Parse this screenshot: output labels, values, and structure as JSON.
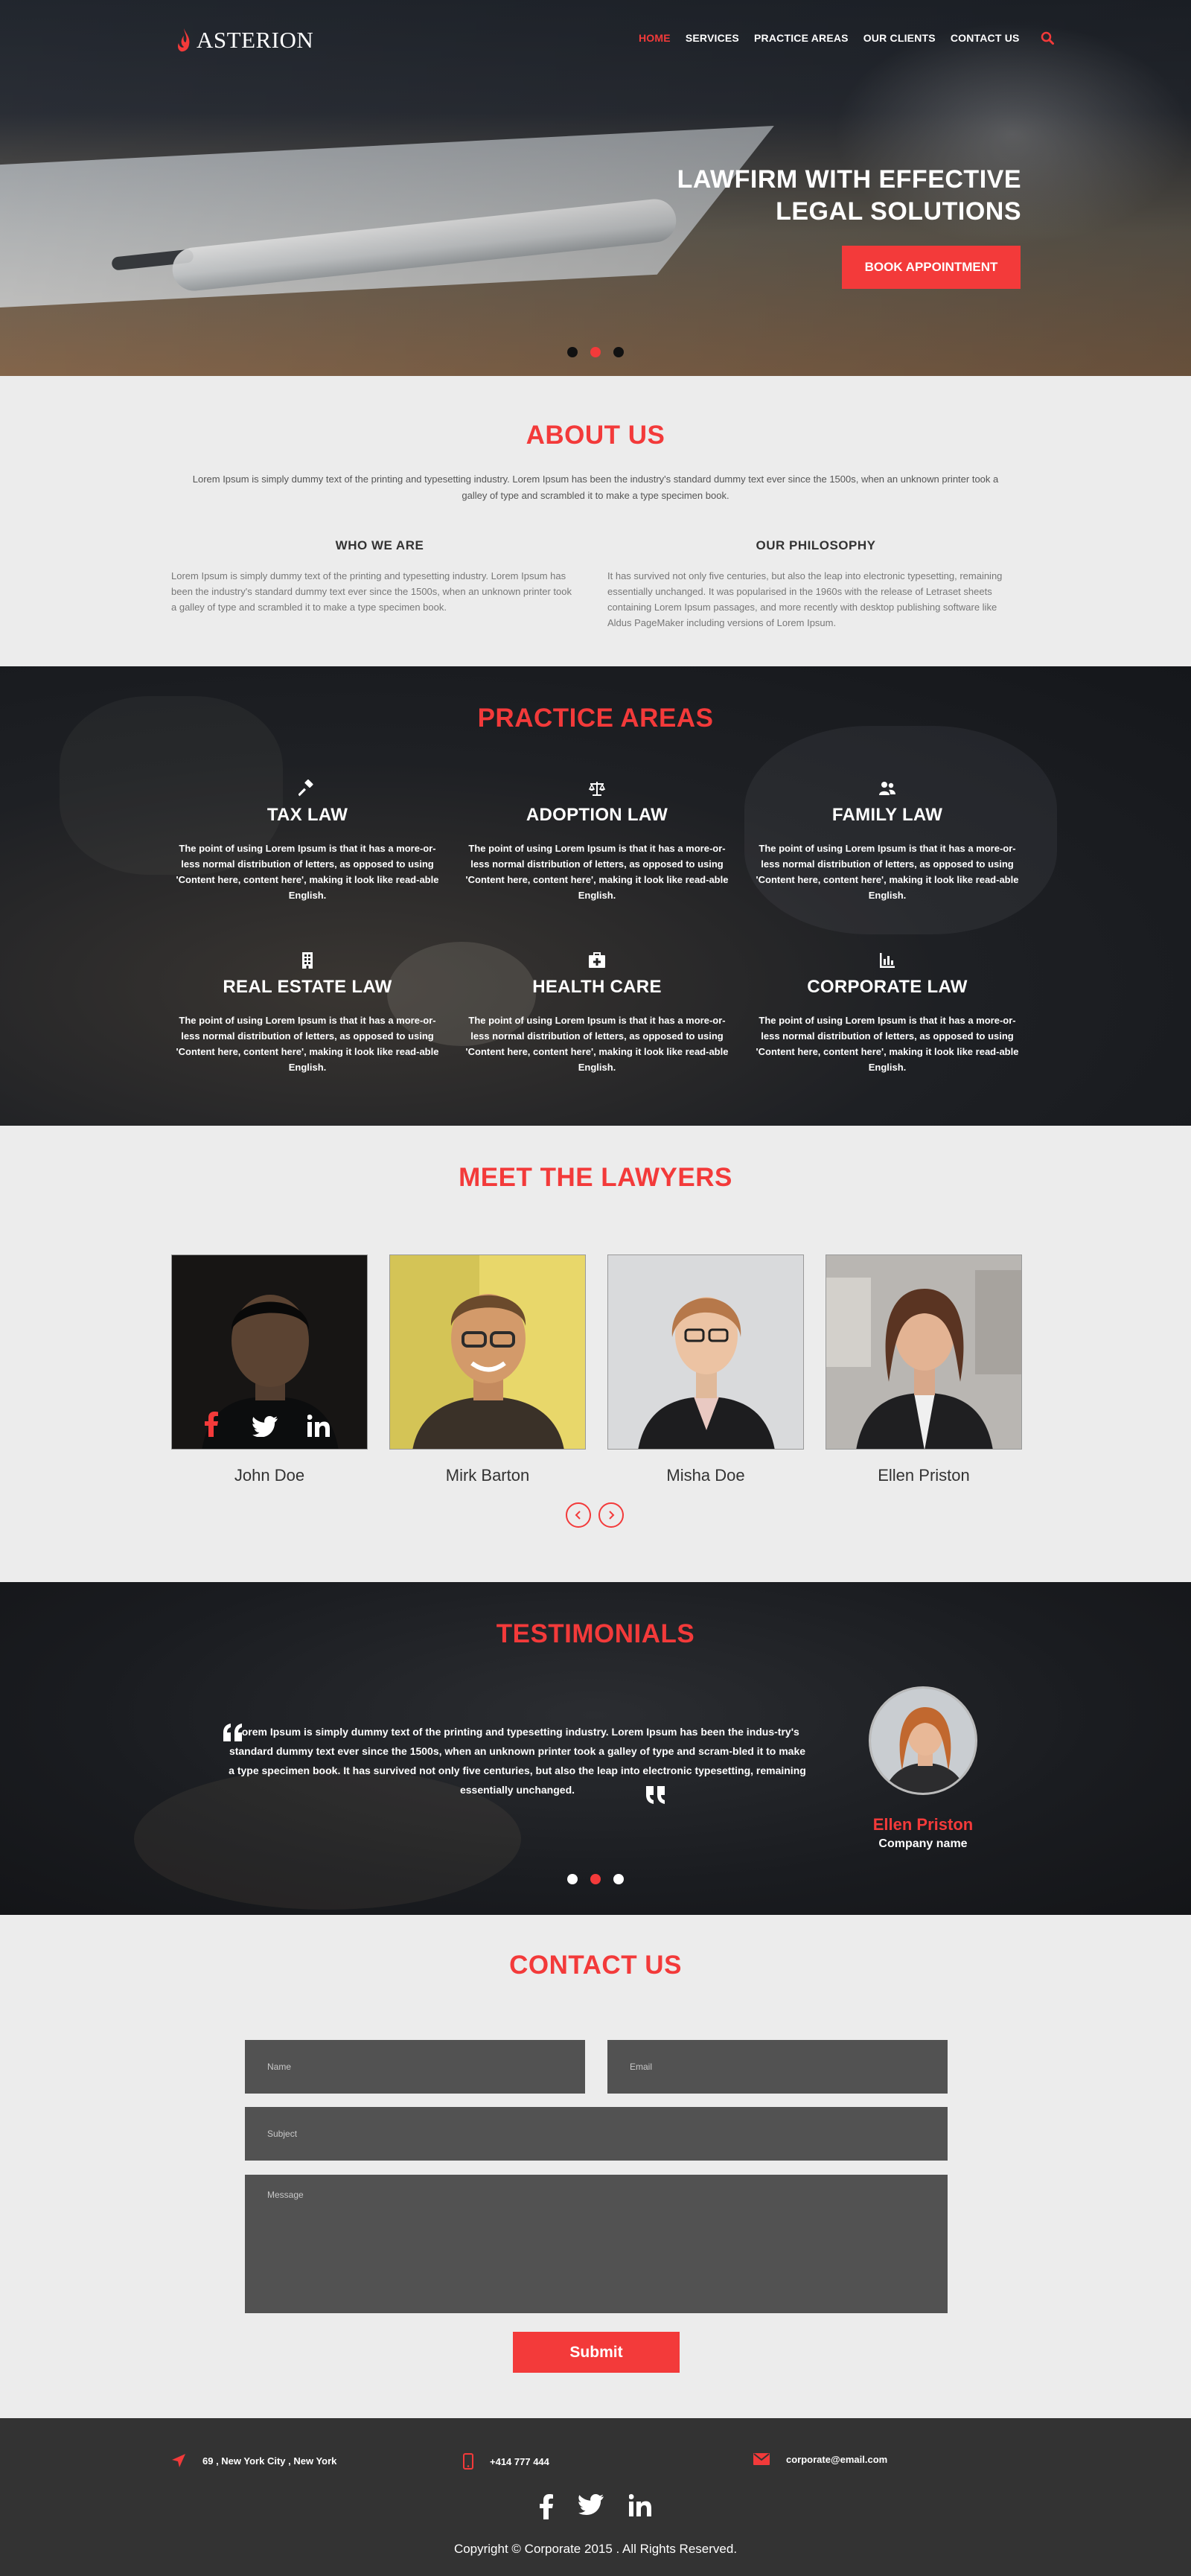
{
  "brand": {
    "name": "ASTERION",
    "accent": "#f33a3a"
  },
  "nav": {
    "items": [
      {
        "label": "HOME",
        "active": true
      },
      {
        "label": "SERVICES",
        "active": false
      },
      {
        "label": "PRACTICE AREAS",
        "active": false
      },
      {
        "label": "OUR CLIENTS",
        "active": false
      },
      {
        "label": "CONTACT US",
        "active": false
      }
    ],
    "search_icon": "search-icon"
  },
  "hero": {
    "title_line1": "LAWFIRM WITH EFFECTIVE",
    "title_line2": "LEGAL SOLUTIONS",
    "button": "BOOK APPOINTMENT",
    "slides": 3,
    "active_slide": 2
  },
  "about": {
    "title": "ABOUT US",
    "intro": "Lorem Ipsum is simply dummy text of the printing and typesetting industry. Lorem Ipsum has been the industry's standard dummy text ever since the 1500s, when an unknown printer took a galley of type and scrambled it to make a type specimen book.",
    "who_title": "WHO WE ARE",
    "who_text": "Lorem Ipsum is simply dummy text of the printing and typesetting industry. Lorem Ipsum has been the industry's standard dummy text ever since the 1500s, when an unknown printer took a galley of type and scrambled it to make a type specimen book.",
    "philosophy_title": "OUR PHILOSOPHY",
    "philosophy_text": "It has survived not only five centuries, but also the leap into electronic typesetting, remaining essentially unchanged. It was popularised in the 1960s with the release of Letraset sheets containing Lorem Ipsum passages, and more recently with desktop publishing software like Aldus PageMaker including versions of Lorem Ipsum."
  },
  "practice": {
    "title": "PRACTICE AREAS",
    "areas": [
      {
        "name": "TAX LAW",
        "icon": "gavel-icon",
        "text": "The point of using Lorem Ipsum is that it has a more-or-less normal distribution of letters, as opposed to using 'Content here, content here', making it look like read-able English."
      },
      {
        "name": "ADOPTION LAW",
        "icon": "scales-icon",
        "text": "The point of using Lorem Ipsum is that it has a more-or-less normal distribution of letters, as opposed to using 'Content here, content here', making it look like read-able English."
      },
      {
        "name": "FAMILY LAW",
        "icon": "family-icon",
        "text": "The point of using Lorem Ipsum is that it has a more-or-less normal distribution of letters, as opposed to using 'Content here, content here', making it look like read-able English."
      },
      {
        "name": "REAL ESTATE LAW",
        "icon": "building-icon",
        "text": "The point of using Lorem Ipsum is that it has a more-or-less normal distribution of letters, as opposed to using 'Content here, content here', making it look like read-able English."
      },
      {
        "name": "HEALTH CARE",
        "icon": "medkit-icon",
        "text": "The point of using Lorem Ipsum is that it has a more-or-less normal distribution of letters, as opposed to using 'Content here, content here', making it look like read-able English."
      },
      {
        "name": "CORPORATE LAW",
        "icon": "chart-icon",
        "text": "The point of using Lorem Ipsum is that it has a more-or-less normal distribution of letters, as opposed to using 'Content here, content here', making it look like read-able English."
      }
    ]
  },
  "lawyers": {
    "title": "MEET THE LAWYERS",
    "people": [
      {
        "name": "John Doe"
      },
      {
        "name": "Mirk Barton"
      },
      {
        "name": "Misha Doe"
      },
      {
        "name": "Ellen Priston"
      }
    ]
  },
  "testimonials": {
    "title": "TESTIMONIALS",
    "quote": "Lorem Ipsum is simply dummy text of the printing and typesetting industry. Lorem Ipsum has been the indus-try's standard dummy text ever since the 1500s, when an unknown printer took a galley of type and scram-bled it to make a type specimen book. It has survived not only five centuries, but also the leap into electronic typesetting, remaining essentially unchanged.",
    "name": "Ellen Priston",
    "company": "Company name",
    "slides": 3,
    "active_slide": 2
  },
  "contact": {
    "title": "CONTACT US",
    "name_placeholder": "Name",
    "email_placeholder": "Email",
    "subject_placeholder": "Subject",
    "message_placeholder": "Message",
    "submit": "Submit"
  },
  "footer": {
    "address": "69 , New York City , New York",
    "phone": "+414 777 444",
    "email": "corporate@email.com",
    "copyright": "Copyright © Corporate 2015 . All Rights Reserved."
  }
}
